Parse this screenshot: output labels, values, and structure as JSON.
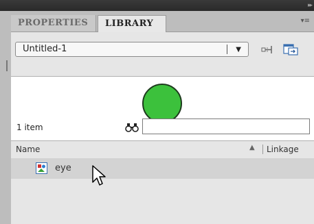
{
  "tabs": [
    {
      "label": "PROPERTIES",
      "active": false
    },
    {
      "label": "LIBRARY",
      "active": true
    }
  ],
  "document": {
    "selected": "Untitled-1"
  },
  "preview": {
    "shape": "circle",
    "fill": "#3cc13c",
    "stroke": "#1e3a1e"
  },
  "library": {
    "item_count": "1 item",
    "search": {
      "value": "",
      "placeholder": ""
    },
    "columns": {
      "name": "Name",
      "linkage": "Linkage"
    },
    "items": [
      {
        "name": "eye",
        "icon": "graphic-symbol-icon"
      }
    ]
  },
  "colors": {
    "panel_bg": "#e6e6e6",
    "selected_row": "#d3d3d3",
    "tab_bar": "#bdbdbd"
  }
}
